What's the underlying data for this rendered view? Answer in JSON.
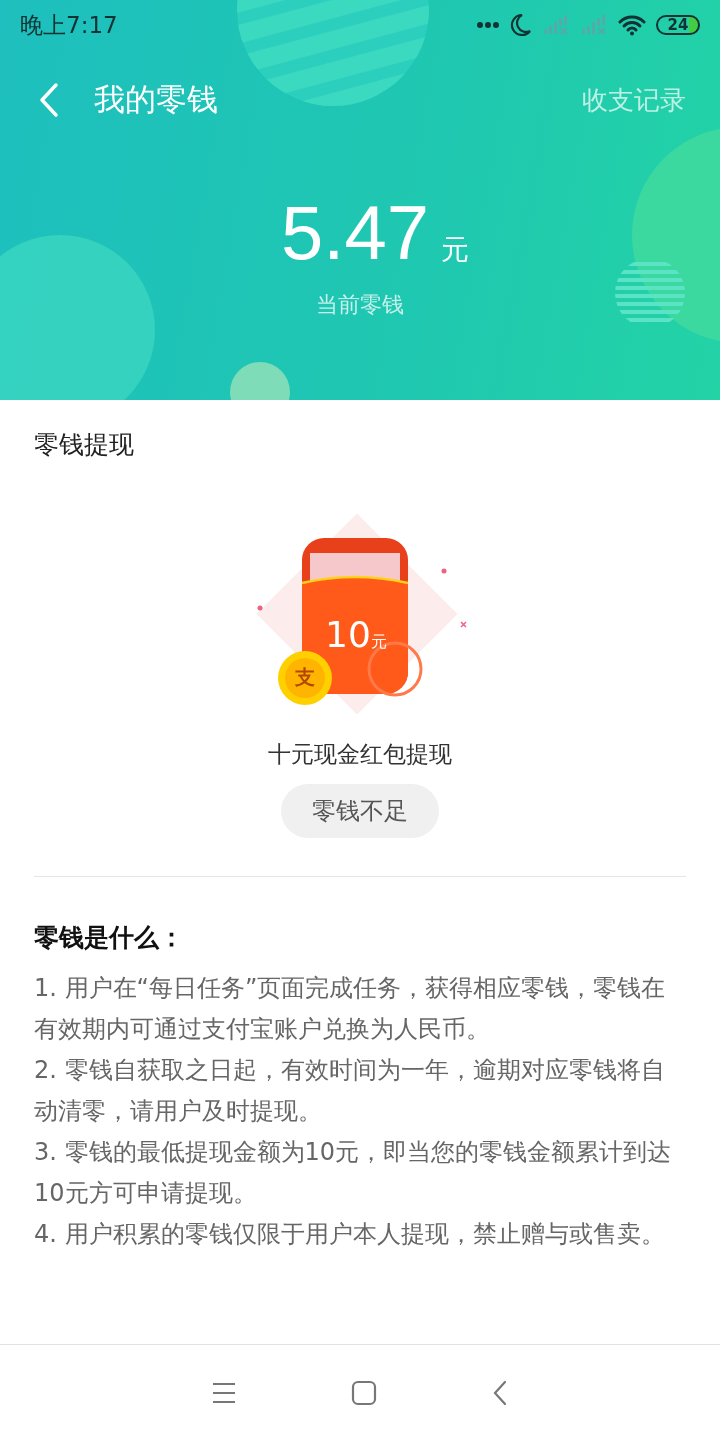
{
  "status_bar": {
    "time": "晚上7:17",
    "battery": "24"
  },
  "header": {
    "title": "我的零钱",
    "action": "收支记录",
    "amount": "5.47",
    "unit": "元",
    "amount_label": "当前零钱"
  },
  "withdraw": {
    "title": "零钱提现",
    "card_amount": "10",
    "card_unit": "元",
    "coin_glyph": "支",
    "caption": "十元现金红包提现",
    "button": {
      "label": "零钱不足",
      "disabled": true
    }
  },
  "rules": {
    "title": "零钱是什么：",
    "items": [
      "1. 用户在“每日任务”页面完成任务，获得相应零钱，零钱在有效期内可通过支付宝账户兑换为人民币。",
      "2. 零钱自获取之日起，有效时间为一年，逾期对应零钱将自动清零，请用户及时提现。",
      "3. 零钱的最低提现金额为10元，即当您的零钱金额累计到达10元方可申请提现。",
      "4. 用户积累的零钱仅限于用户本人提现，禁止赠与或售卖。"
    ]
  }
}
